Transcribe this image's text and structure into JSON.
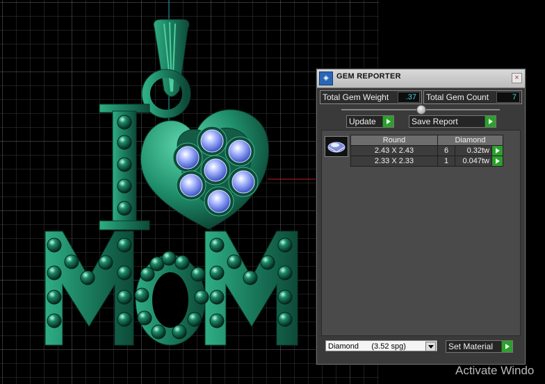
{
  "panel": {
    "title": "GEM REPORTER",
    "close_symbol": "×",
    "total_gem_weight_label": "Total Gem Weight",
    "total_gem_weight_value": ".37",
    "total_gem_count_label": "Total Gem Count",
    "total_gem_count_value": "7",
    "update_label": "Update",
    "save_report_label": "Save Report",
    "table": {
      "headers": [
        "Round",
        "Diamond"
      ],
      "rows": [
        {
          "size": "2.43 X 2.43",
          "count": "6",
          "weight": "0.32tw"
        },
        {
          "size": "2.33 X 2.33",
          "count": "1",
          "weight": "0.047tw"
        }
      ]
    },
    "material_select": "Diamond      (3.52 spg)",
    "set_material_label": "Set Material"
  },
  "watermark": "Activate Windo",
  "colors": {
    "pendant": "#1f8f6b",
    "gem": "#8fa6ff",
    "accent_green": "#2e9e2e",
    "value_text": "#3fd3e0"
  }
}
